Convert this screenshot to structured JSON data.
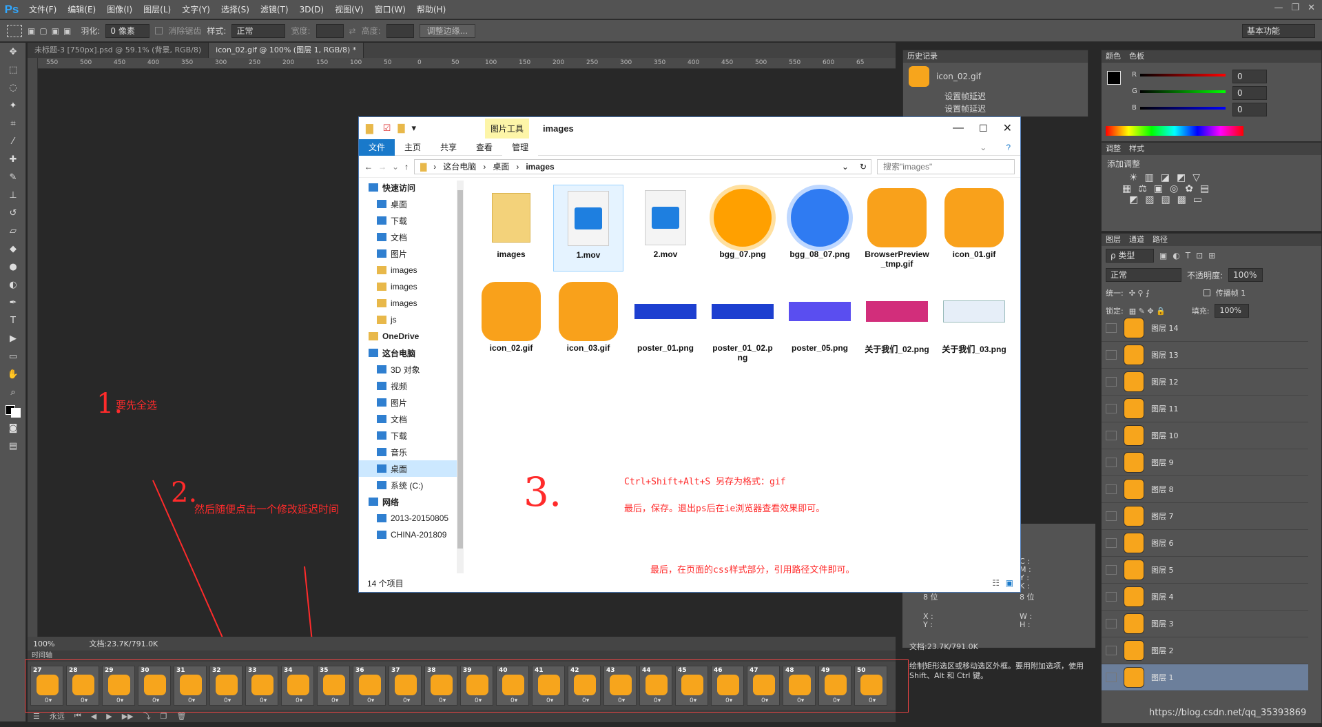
{
  "app": {
    "logo": "Ps"
  },
  "menu": [
    "文件(F)",
    "编辑(E)",
    "图像(I)",
    "图层(L)",
    "文字(Y)",
    "选择(S)",
    "滤镜(T)",
    "3D(D)",
    "视图(V)",
    "窗口(W)",
    "帮助(H)"
  ],
  "options": {
    "feather_label": "羽化:",
    "feather_value": "0 像素",
    "antialias": "消除锯齿",
    "style_label": "样式:",
    "style_value": "正常",
    "width_label": "宽度:",
    "height_label": "高度:",
    "refine": "调整边缘...",
    "workspace": "基本功能"
  },
  "doc_tabs": [
    "未标题-3 [750px].psd @ 59.1% (背景, RGB/8)",
    "icon_02.gif @ 100% (图层 1, RGB/8) *"
  ],
  "ruler_ticks": [
    "550",
    "500",
    "450",
    "400",
    "350",
    "300",
    "250",
    "200",
    "150",
    "100",
    "50",
    "0",
    "50",
    "100",
    "150",
    "200",
    "250",
    "300",
    "350",
    "400",
    "450",
    "500",
    "550",
    "600",
    "65"
  ],
  "annotations": {
    "step1_num": "1.",
    "step1_text": "要先全选",
    "step2_num": "2.",
    "step2_text": "然后随便点击一个修改延迟时间",
    "step3_num": "3.",
    "step3_line1": "Ctrl+Shift+Alt+S  另存为格式：gif",
    "step3_line2": "最后，保存。退出ps后在ie浏览器查看效果即可。",
    "step3_line3": "最后，在页面的css样式部分，引用路径文件即可。"
  },
  "status": {
    "zoom": "100%",
    "doc": "文档:23.7K/791.0K"
  },
  "timeline": {
    "title": "时间轴",
    "frames": [
      "27",
      "28",
      "29",
      "30",
      "31",
      "32",
      "33",
      "34",
      "35",
      "36",
      "37",
      "38",
      "39",
      "40",
      "41",
      "42",
      "43",
      "44",
      "45",
      "46",
      "47",
      "48",
      "49",
      "50"
    ],
    "delay": "0▾",
    "loop": "永远"
  },
  "history": {
    "title": "历史记录",
    "snapshot": "icon_02.gif",
    "items": [
      "设置帧延迟",
      "设置帧延迟"
    ]
  },
  "color_panel": {
    "tabs": [
      "颜色",
      "色板"
    ],
    "r": "R",
    "g": "G",
    "b": "B",
    "rv": "0",
    "gv": "0",
    "bv": "0"
  },
  "adjust_panel": {
    "tabs": [
      "调整",
      "样式"
    ],
    "title": "添加调整"
  },
  "layers_panel": {
    "tabs": [
      "图层",
      "通道",
      "路径"
    ],
    "kind": "ρ 类型",
    "blend": "正常",
    "opacity_label": "不透明度:",
    "opacity": "100%",
    "unify": "统一:",
    "propagate": "传播帧 1",
    "lock": "锁定:",
    "fill_label": "填充:",
    "fill": "100%",
    "layers": [
      "图层 14",
      "图层 13",
      "图层 12",
      "图层 11",
      "图层 10",
      "图层 9",
      "图层 8",
      "图层 7",
      "图层 6",
      "图层 5",
      "图层 4",
      "图层 3",
      "图层 2",
      "图层 1"
    ]
  },
  "info": {
    "c": "C :",
    "m": "M :",
    "y": "Y :",
    "k": "K :",
    "bit1": "8 位",
    "bit2": "8 位",
    "x": "X :",
    "yy": "Y :",
    "w": "W :",
    "h": "H :",
    "doc": "文档:23.7K/791.0K",
    "hint": "绘制矩形选区或移动选区外框。要用附加选项，使用 Shift、Alt 和 Ctrl 键。"
  },
  "explorer": {
    "tool_tab": "图片工具",
    "title": "images",
    "ribbon": [
      "文件",
      "主页",
      "共享",
      "查看",
      "管理"
    ],
    "path": [
      "这台电脑",
      "桌面",
      "images"
    ],
    "search": "搜索\"images\"",
    "nav": [
      "快速访问",
      "桌面",
      "下载",
      "文档",
      "图片",
      "images",
      "images",
      "images",
      "js",
      "OneDrive",
      "这台电脑",
      "3D 对象",
      "视频",
      "图片",
      "文档",
      "下载",
      "音乐",
      "桌面",
      "系统 (C:)",
      "网络",
      "2013-20150805",
      "CHINA-201809"
    ],
    "files": [
      "images",
      "1.mov",
      "2.mov",
      "bgg_07.png",
      "bgg_08_07.png",
      "BrowserPreview_tmp.gif",
      "icon_01.gif",
      "icon_02.gif",
      "icon_03.gif",
      "poster_01.png",
      "poster_01_02.png",
      "poster_05.png",
      "关于我们_02.png",
      "关于我们_03.png"
    ],
    "count": "14 个项目"
  },
  "watermark": "https://blog.csdn.net/qq_35393869",
  "colors": {
    "accent": "#31a8ff",
    "orange": "#f7a51c",
    "annot": "#ff2b2b",
    "blue": "#1979ca"
  }
}
